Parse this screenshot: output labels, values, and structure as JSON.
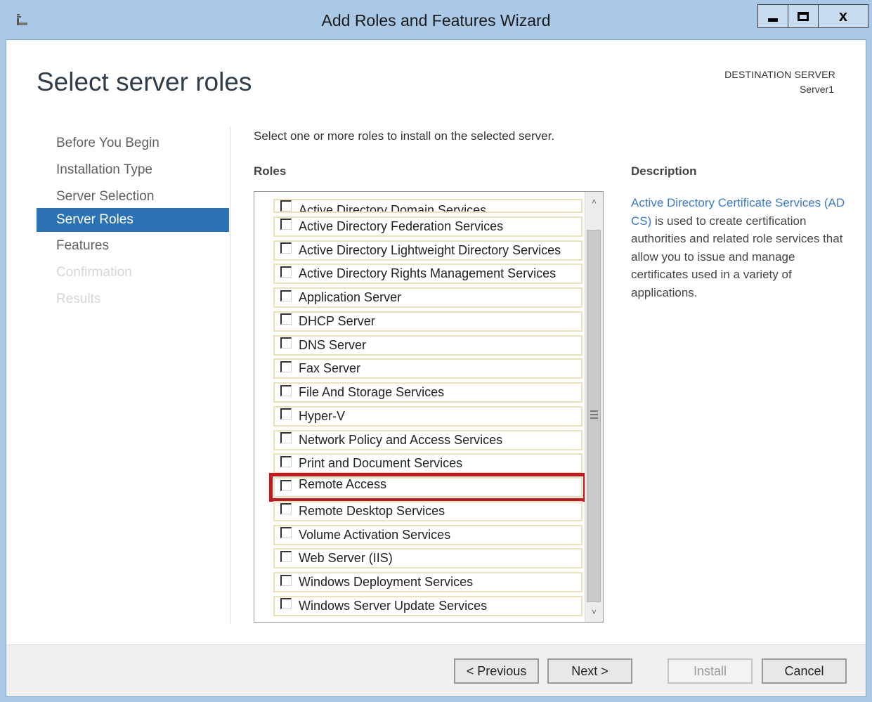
{
  "window": {
    "title": "Add Roles and Features Wizard",
    "close_glyph": "x"
  },
  "page": {
    "heading": "Select server roles",
    "destination_label": "DESTINATION SERVER",
    "destination_server": "Server1",
    "instruction": "Select one or more roles to install on the selected server.",
    "roles_label": "Roles",
    "description_label": "Description"
  },
  "nav": {
    "items": [
      {
        "label": "Before You Begin",
        "state": "normal"
      },
      {
        "label": "Installation Type",
        "state": "normal"
      },
      {
        "label": "Server Selection",
        "state": "normal"
      },
      {
        "label": "Server Roles",
        "state": "active"
      },
      {
        "label": "Features",
        "state": "normal"
      },
      {
        "label": "Confirmation",
        "state": "disabled"
      },
      {
        "label": "Results",
        "state": "disabled"
      }
    ]
  },
  "roles": [
    "Active Directory Domain Services",
    "Active Directory Federation Services",
    "Active Directory Lightweight Directory Services",
    "Active Directory Rights Management Services",
    "Application Server",
    "DHCP Server",
    "DNS Server",
    "Fax Server",
    "File And Storage Services",
    "Hyper-V",
    "Network Policy and Access Services",
    "Print and Document Services",
    "Remote Access",
    "Remote Desktop Services",
    "Volume Activation Services",
    "Web Server (IIS)",
    "Windows Deployment Services",
    "Windows Server Update Services"
  ],
  "highlighted_role": "Remote Access",
  "description": {
    "link_text": "Active Directory Certificate Services (AD CS)",
    "body_text": " is used to create certification authorities and related role services that allow you to issue and manage certificates used in a variety of applications."
  },
  "buttons": {
    "previous": "< Previous",
    "next": "Next >",
    "install": "Install",
    "cancel": "Cancel"
  },
  "colors": {
    "titlebar": "#a9c9e6",
    "nav_active": "#2a72b4",
    "highlight": "#c8161e",
    "link": "#3a7bc8"
  }
}
